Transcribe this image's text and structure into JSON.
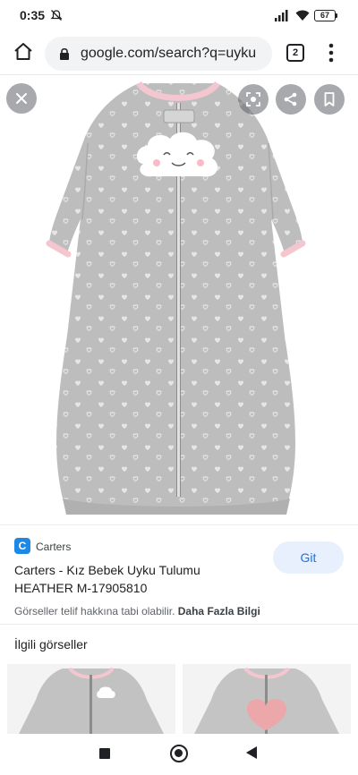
{
  "status_bar": {
    "time": "0:35",
    "battery": "67",
    "icons": [
      "mute-icon",
      "signal-icon",
      "wifi-icon",
      "battery-icon"
    ]
  },
  "browser": {
    "url": "google.com/search?q=uyku",
    "tab_count": "2",
    "icons": [
      "home-icon",
      "lock-icon",
      "tabs-icon",
      "more-vert-icon"
    ]
  },
  "image_viewer": {
    "icons": [
      "close-icon",
      "lens-icon",
      "share-icon",
      "bookmark-icon"
    ]
  },
  "result": {
    "site_initial": "C",
    "site": "Carters",
    "title_line1": "Carters - Kız Bebek Uyku Tulumu",
    "title_line2": "HEATHER M-17905810",
    "visit_label": "Git",
    "copyright": "Görseller telif hakkına tabi olabilir.",
    "more_info": "Daha Fazla Bilgi"
  },
  "related": {
    "title": "İlgili görseller"
  },
  "colors": {
    "accent": "#1a73e8",
    "accent_bg": "#e8f0fe",
    "garment_gray": "#bdbdbd",
    "trim_pink": "#f4c6cf"
  }
}
